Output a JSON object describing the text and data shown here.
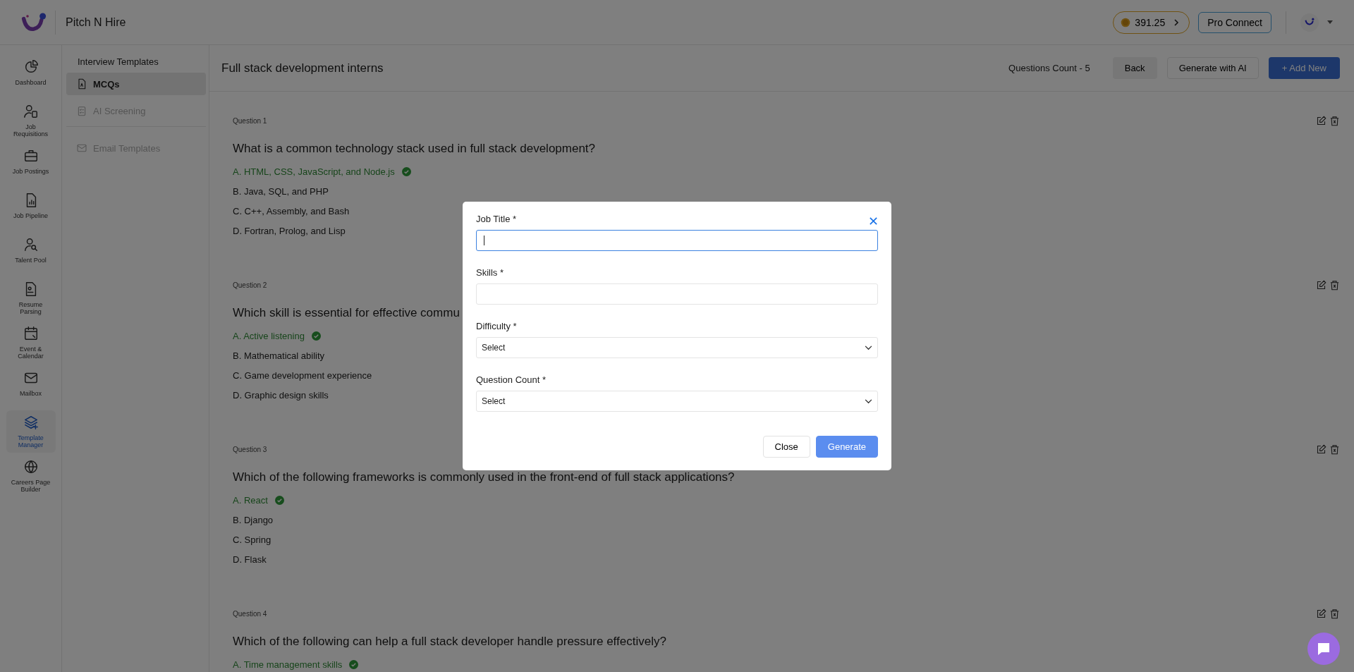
{
  "app": {
    "name": "Pitch N Hire"
  },
  "top_bar": {
    "coins": "391.25",
    "pro_button": "Pro Connect"
  },
  "nav": [
    {
      "label": "Dashboard",
      "selected": false
    },
    {
      "label": "Job Requisitions",
      "selected": false
    },
    {
      "label": "Job Postings",
      "selected": false
    },
    {
      "label": "Job Pipeline",
      "selected": false
    },
    {
      "label": "Talent Pool",
      "selected": false
    },
    {
      "label": "Resume Parsing",
      "selected": false
    },
    {
      "label": "Event & Calendar",
      "selected": false
    },
    {
      "label": "Mailbox",
      "selected": false
    },
    {
      "label": "Template Manager",
      "selected": true
    },
    {
      "label": "Careers Page Builder",
      "selected": false
    }
  ],
  "sub_sidebar": {
    "title": "Interview Templates",
    "items": [
      {
        "label": "MCQs",
        "selected": true,
        "disabled": false
      },
      {
        "label": "AI Screening",
        "selected": false,
        "disabled": true
      },
      {
        "label": "Email Templates",
        "selected": false,
        "disabled": true
      }
    ]
  },
  "header": {
    "title": "Full stack development interns",
    "count": "Questions Count - 5",
    "buttons": [
      {
        "label": "Back",
        "kind": "grey"
      },
      {
        "label": "Generate with AI",
        "kind": "outline"
      },
      {
        "label": "+ Add New",
        "kind": "primary"
      }
    ]
  },
  "questions": [
    {
      "label": "Question 1",
      "text": "What is a common technology stack used in full stack development?",
      "options": [
        {
          "text": "A. HTML, CSS, JavaScript, and Node.js",
          "correct": true
        },
        {
          "text": "B. Java, SQL, and PHP",
          "correct": false
        },
        {
          "text": "C. C++, Assembly, and Bash",
          "correct": false
        },
        {
          "text": "D. Fortran, Prolog, and Lisp",
          "correct": false
        }
      ]
    },
    {
      "label": "Question 2",
      "text": "Which skill is essential for effective commu",
      "options": [
        {
          "text": "A. Active listening",
          "correct": true
        },
        {
          "text": "B. Mathematical ability",
          "correct": false
        },
        {
          "text": "C. Game development experience",
          "correct": false
        },
        {
          "text": "D. Graphic design skills",
          "correct": false
        }
      ]
    },
    {
      "label": "Question 3",
      "text": "Which of the following frameworks is commonly used in the front-end of full stack applications?",
      "options": [
        {
          "text": "A. React",
          "correct": true
        },
        {
          "text": "B. Django",
          "correct": false
        },
        {
          "text": "C. Spring",
          "correct": false
        },
        {
          "text": "D. Flask",
          "correct": false
        }
      ]
    },
    {
      "label": "Question 4",
      "text": "Which of the following can help a full stack developer handle pressure effectively?",
      "options": [
        {
          "text": "A. Time management skills",
          "correct": true
        }
      ]
    }
  ],
  "modal": {
    "fields": [
      {
        "label": "Job Title *",
        "kind": "text",
        "focused": true
      },
      {
        "label": "Skills *",
        "kind": "text",
        "focused": false
      },
      {
        "label": "Difficulty *",
        "kind": "select",
        "placeholder": "Select",
        "focused": false
      },
      {
        "label": "Question Count *",
        "kind": "select",
        "placeholder": "Select",
        "focused": false
      }
    ],
    "buttons": [
      {
        "label": "Close",
        "kind": "outline"
      },
      {
        "label": "Generate",
        "kind": "primary"
      }
    ]
  }
}
